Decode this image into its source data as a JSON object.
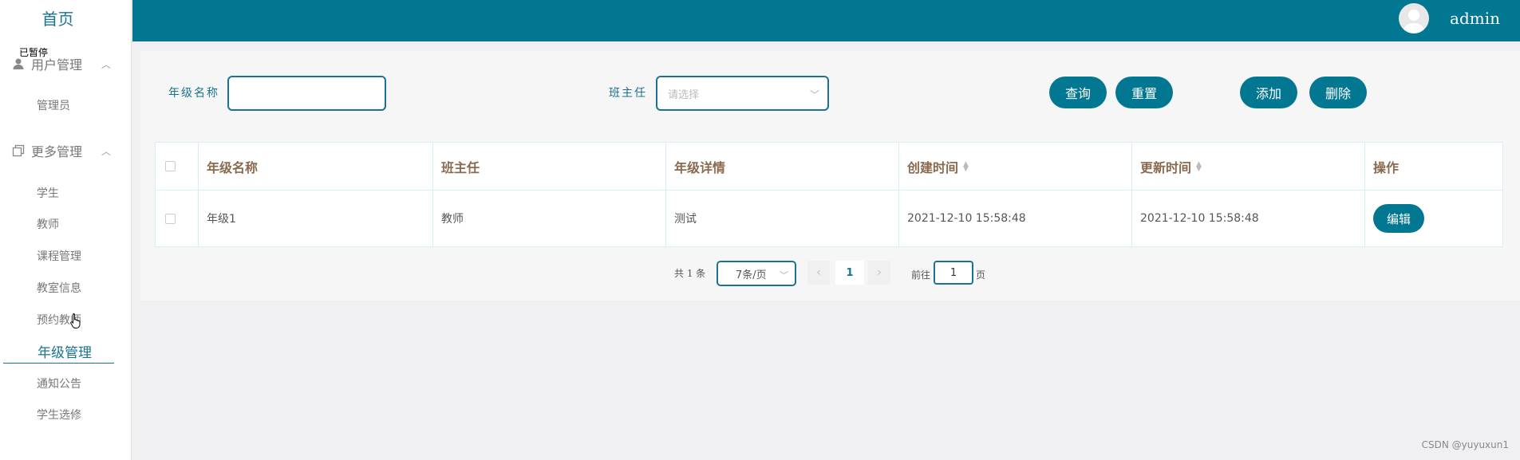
{
  "sidebar": {
    "home": "首页",
    "tooltip": "已暂停",
    "groups": [
      {
        "label": "用户管理",
        "icon": "user-icon",
        "items": [
          "管理员"
        ]
      },
      {
        "label": "更多管理",
        "icon": "copy-icon",
        "items": [
          "学生",
          "教师",
          "课程管理",
          "教室信息",
          "预约教师",
          "年级管理",
          "通知公告",
          "学生选修"
        ]
      }
    ],
    "active_item": "年级管理"
  },
  "header": {
    "username": "admin",
    "avatar_icon": "avatar-icon"
  },
  "search": {
    "grade_label": "年级名称",
    "grade_value": "",
    "teacher_label": "班主任",
    "teacher_placeholder": "请选择",
    "query_button": "查询",
    "reset_button": "重置",
    "add_button": "添加",
    "delete_button": "删除"
  },
  "table": {
    "columns": [
      "年级名称",
      "班主任",
      "年级详情",
      "创建时间",
      "更新时间",
      "操作"
    ],
    "rows": [
      {
        "grade": "年级1",
        "teacher": "教师",
        "detail": "测试",
        "created": "2021-12-10 15:58:48",
        "updated": "2021-12-10 15:58:48",
        "action": "编辑"
      }
    ]
  },
  "pagination": {
    "total": "共 1 条",
    "page_size": "7条/页",
    "current_page": "1",
    "goto_label": "前往",
    "goto_value": "1",
    "page_suffix": "页"
  },
  "watermark": "CSDN @yuyuxun1",
  "colors": {
    "primary": "#027791",
    "text_accent": "#1a7390",
    "header_text": "#8a6a4f"
  }
}
